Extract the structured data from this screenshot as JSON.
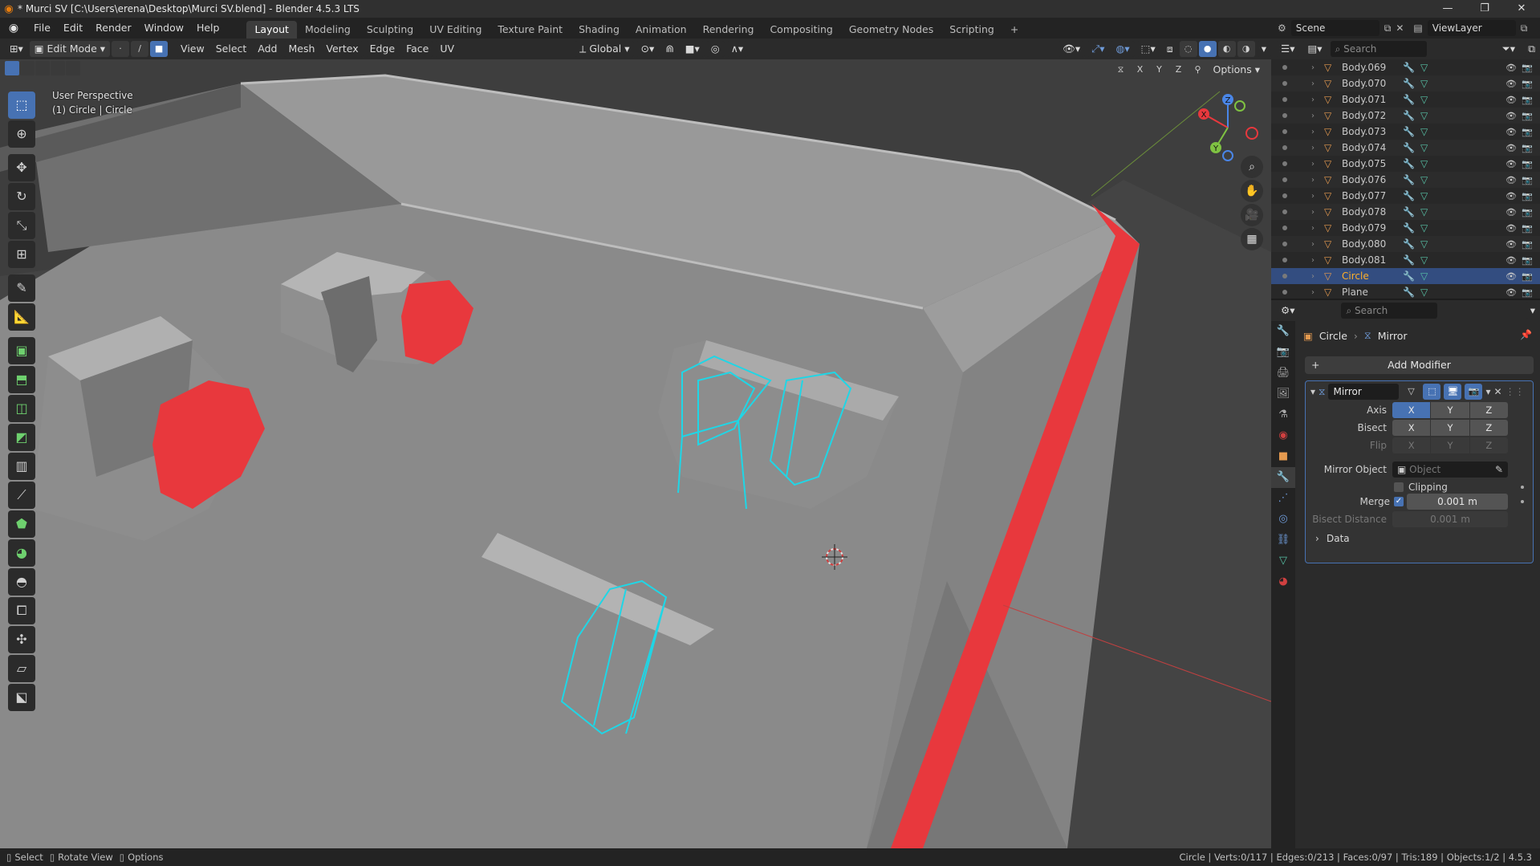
{
  "window": {
    "title": "* Murci SV [C:\\Users\\erena\\Desktop\\Murci SV.blend] - Blender 4.5.3 LTS",
    "buttons": [
      "—",
      "❐",
      "✕"
    ]
  },
  "menu": [
    "File",
    "Edit",
    "Render",
    "Window",
    "Help"
  ],
  "workspaces": [
    {
      "label": "Layout",
      "active": true
    },
    {
      "label": "Modeling"
    },
    {
      "label": "Sculpting"
    },
    {
      "label": "UV Editing"
    },
    {
      "label": "Texture Paint"
    },
    {
      "label": "Shading"
    },
    {
      "label": "Animation"
    },
    {
      "label": "Rendering"
    },
    {
      "label": "Compositing"
    },
    {
      "label": "Geometry Nodes"
    },
    {
      "label": "Scripting"
    }
  ],
  "scene": {
    "label": "Scene",
    "view_layer": "ViewLayer"
  },
  "viewport_header": {
    "mode": "Edit Mode",
    "menus": [
      "View",
      "Select",
      "Add",
      "Mesh",
      "Vertex",
      "Edge",
      "Face",
      "UV"
    ],
    "transform_orientation": "Global",
    "options_label": "Options",
    "axes": [
      "X",
      "Y",
      "Z"
    ]
  },
  "viewport": {
    "perspective": "User Perspective",
    "object_info": "(1) Circle | Circle",
    "gizmo_labels": {
      "x": "X",
      "y": "Y",
      "z": "Z"
    }
  },
  "outliner": {
    "search_placeholder": "Search",
    "items": [
      {
        "name": "Body.069"
      },
      {
        "name": "Body.070"
      },
      {
        "name": "Body.071"
      },
      {
        "name": "Body.072"
      },
      {
        "name": "Body.073"
      },
      {
        "name": "Body.074"
      },
      {
        "name": "Body.075"
      },
      {
        "name": "Body.076"
      },
      {
        "name": "Body.077"
      },
      {
        "name": "Body.078"
      },
      {
        "name": "Body.079"
      },
      {
        "name": "Body.080"
      },
      {
        "name": "Body.081"
      },
      {
        "name": "Circle",
        "selected": true
      },
      {
        "name": "Plane"
      }
    ]
  },
  "properties": {
    "search_placeholder": "Search",
    "breadcrumb": {
      "object": "Circle",
      "modifier": "Mirror"
    },
    "add_modifier": "Add Modifier",
    "modifier": {
      "name": "Mirror",
      "axis_label": "Axis",
      "bisect_label": "Bisect",
      "flip_label": "Flip",
      "axis_values": [
        "X",
        "Y",
        "Z"
      ],
      "mirror_object_label": "Mirror Object",
      "mirror_object_placeholder": "Object",
      "clipping_label": "Clipping",
      "merge_label": "Merge",
      "merge_value": "0.001 m",
      "merge_checked": true,
      "bisect_distance_label": "Bisect Distance",
      "bisect_distance_value": "0.001 m",
      "data_label": "Data"
    }
  },
  "statusbar": {
    "hints": [
      "Select",
      "Rotate View",
      "Options"
    ],
    "stats": "Circle | Verts:0/117 | Edges:0/213 | Faces:0/97 | Tris:189 | Objects:1/2 | 4.5.3"
  },
  "colors": {
    "accent": "#4772b3",
    "selection_orange": "#ffaf29",
    "edit_cyan": "#1fd6e6",
    "red_face": "#e8383d"
  }
}
